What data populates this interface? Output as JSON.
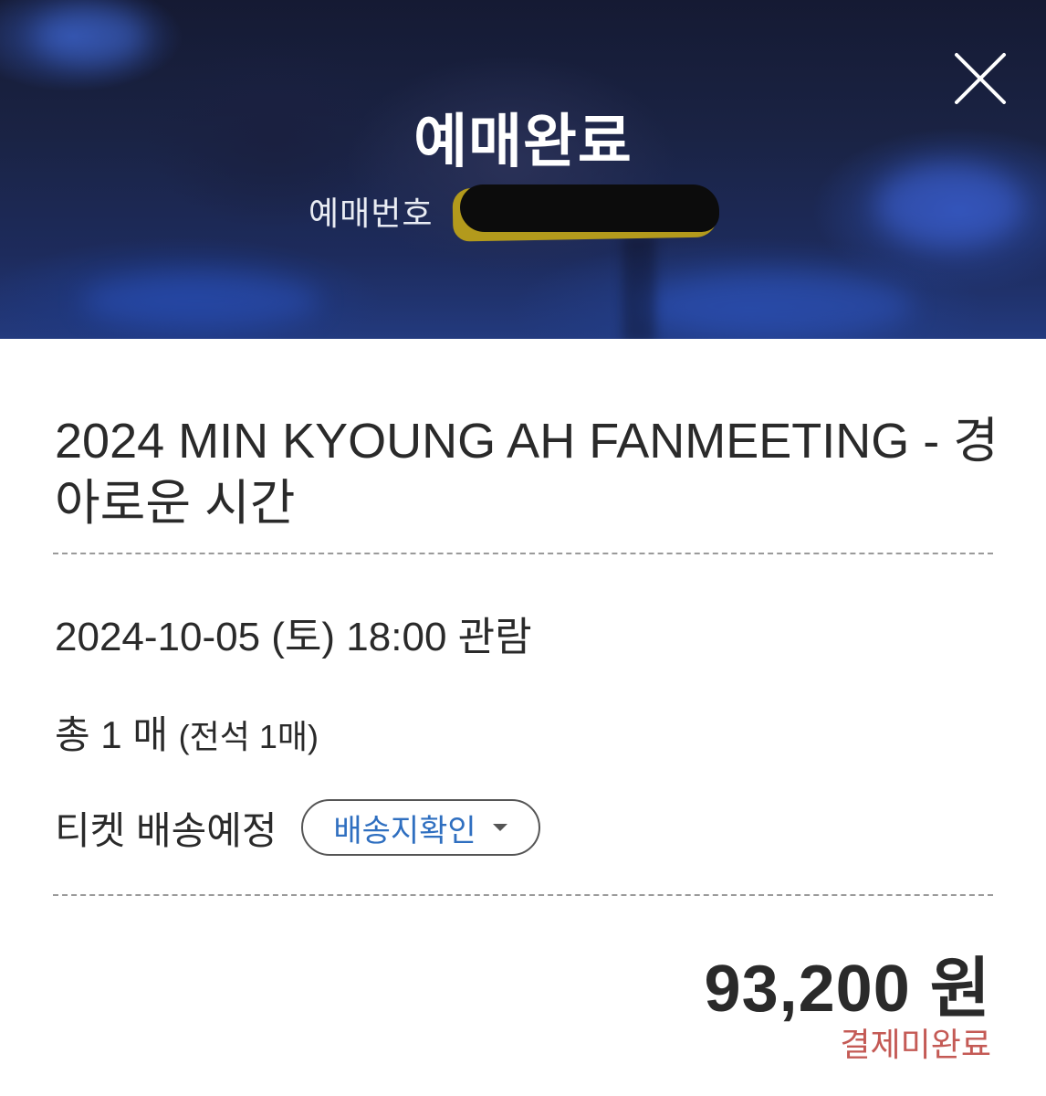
{
  "header": {
    "title": "예매완료",
    "booking_number_label": "예매번호",
    "close_icon": "close-icon"
  },
  "ticket": {
    "event_title": "2024 MIN KYOUNG AH FANMEETING - 경아로운 시간",
    "date_time": "2024-10-05 (토) 18:00 관람",
    "quantity": "총 1 매",
    "quantity_detail": "(전석 1매)",
    "delivery_status": "티켓 배송예정",
    "address_button_label": "배송지확인",
    "price": "93,200 원",
    "payment_status": "결제미완료"
  },
  "colors": {
    "address_button_text": "#2f6fc0",
    "payment_status": "#c45a55",
    "header_background": "#1d2b5c"
  }
}
